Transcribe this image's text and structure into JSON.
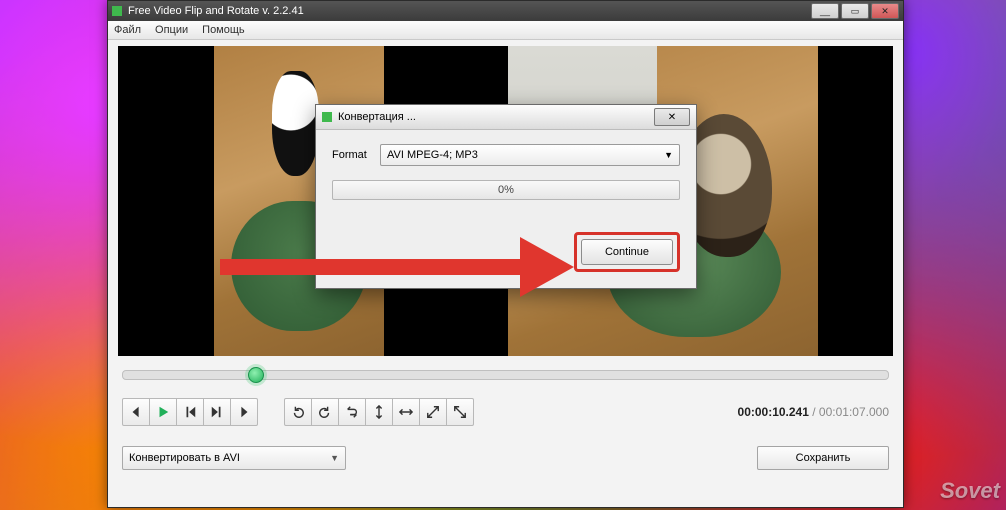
{
  "window": {
    "title": "Free Video Flip and Rotate v. 2.2.41",
    "min_glyph": "__",
    "max_glyph": "▭",
    "close_glyph": "✕"
  },
  "menu": {
    "file": "Файл",
    "options": "Опции",
    "help": "Помощь"
  },
  "timecode": {
    "current": "00:00:10.241",
    "sep": " /  ",
    "duration": "00:01:07.000"
  },
  "convert_combo": {
    "value": "Конвертировать в AVI"
  },
  "save_button": "Сохранить",
  "dialog": {
    "title": "Конвертация ...",
    "close_glyph": "✕",
    "format_label": "Format",
    "format_value": "AVI MPEG-4; MP3",
    "progress_text": "0%",
    "continue": "Continue"
  },
  "watermark": "Sovet"
}
